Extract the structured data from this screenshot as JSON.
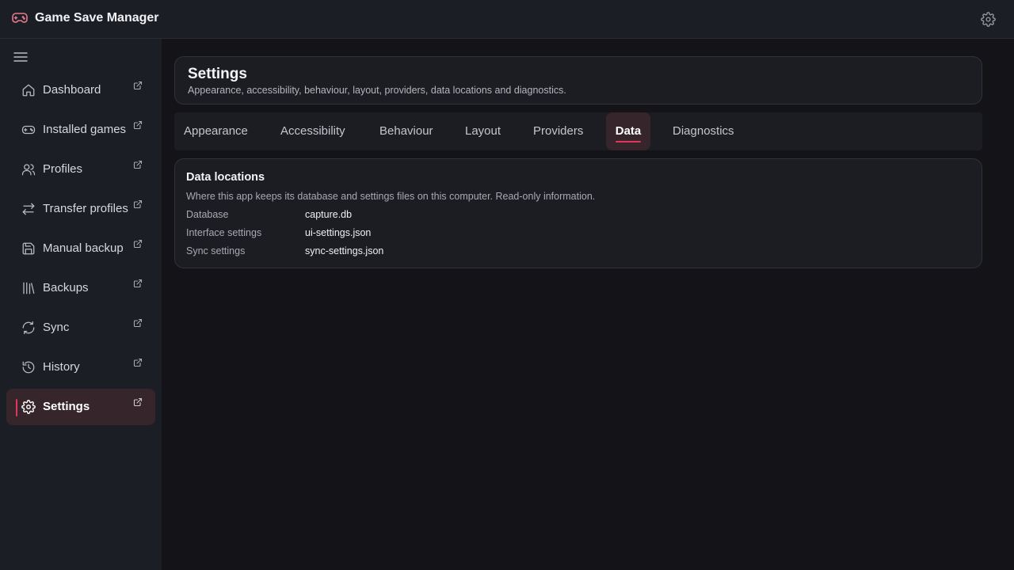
{
  "app": {
    "title": "Game Save Manager",
    "logo_icon": "gamepad-icon",
    "settings_icon": "gear-icon"
  },
  "sidebar": {
    "menu_icon": "hamburger-menu-icon",
    "items": [
      {
        "label": "Dashboard",
        "icon": "home-icon",
        "active": false
      },
      {
        "label": "Installed games",
        "icon": "gamepad-icon",
        "active": false
      },
      {
        "label": "Profiles",
        "icon": "users-icon",
        "active": false
      },
      {
        "label": "Transfer profiles",
        "icon": "transfer-icon",
        "active": false
      },
      {
        "label": "Manual backup",
        "icon": "save-icon",
        "active": false
      },
      {
        "label": "Backups",
        "icon": "library-icon",
        "active": false
      },
      {
        "label": "Sync",
        "icon": "refresh-icon",
        "active": false
      },
      {
        "label": "History",
        "icon": "history-icon",
        "active": false
      },
      {
        "label": "Settings",
        "icon": "gear-icon",
        "active": true
      }
    ]
  },
  "header": {
    "title": "Settings",
    "subtitle": "Appearance, accessibility, behaviour, layout, providers, data locations and diagnostics."
  },
  "tabs": [
    {
      "label": "Appearance",
      "active": false
    },
    {
      "label": "Accessibility",
      "active": false
    },
    {
      "label": "Behaviour",
      "active": false
    },
    {
      "label": "Layout",
      "active": false
    },
    {
      "label": "Providers",
      "active": false
    },
    {
      "label": "Data",
      "active": true
    },
    {
      "label": "Diagnostics",
      "active": false
    }
  ],
  "data_section": {
    "title": "Data locations",
    "description": "Where this app keeps its database and settings files on this computer. Read-only information.",
    "rows": [
      {
        "label": "Database",
        "value": "capture.db"
      },
      {
        "label": "Interface settings",
        "value": "ui-settings.json"
      },
      {
        "label": "Sync settings",
        "value": "sync-settings.json"
      }
    ]
  },
  "colors": {
    "accent": "#e0365c",
    "active_bg": "#36252b",
    "panel_bg": "#1c1d23",
    "page_bg": "#131318"
  }
}
